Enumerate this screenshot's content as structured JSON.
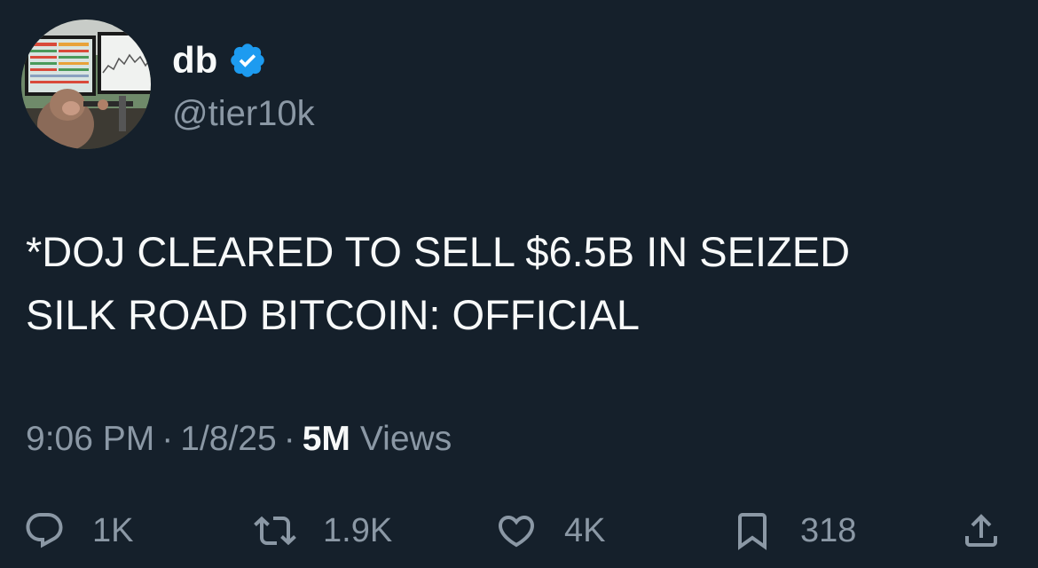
{
  "author": {
    "display_name": "db",
    "handle": "@tier10k",
    "verified": true,
    "verified_color": "#1d9bf0"
  },
  "tweet": {
    "text": "*DOJ CLEARED TO SELL $6.5B IN SEIZED\nSILK ROAD BITCOIN: OFFICIAL"
  },
  "meta": {
    "time": "9:06 PM",
    "separator": "·",
    "date": "1/8/25",
    "views_count": "5M",
    "views_label": "Views"
  },
  "actions": {
    "reply": {
      "icon": "reply-icon",
      "count": "1K"
    },
    "retweet": {
      "icon": "retweet-icon",
      "count": "1.9K"
    },
    "like": {
      "icon": "heart-icon",
      "count": "4K"
    },
    "bookmark": {
      "icon": "bookmark-icon",
      "count": "318"
    },
    "share": {
      "icon": "share-icon"
    }
  },
  "theme": {
    "background": "#15202b",
    "text_primary": "#f7f9f9",
    "text_secondary": "#8b98a5"
  }
}
